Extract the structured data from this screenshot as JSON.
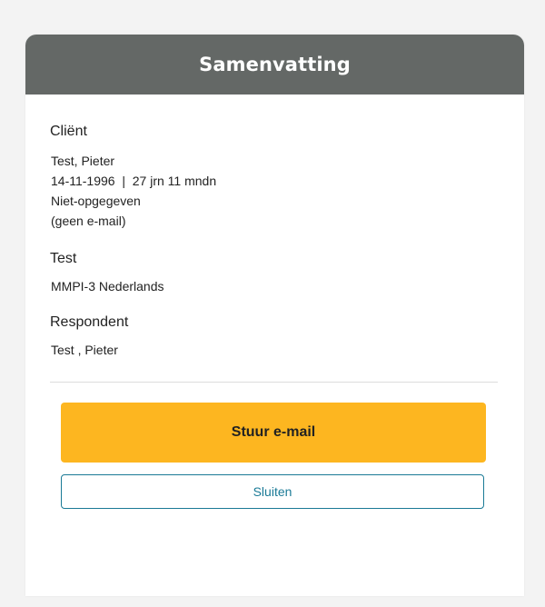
{
  "header": {
    "title": "Samenvatting"
  },
  "client": {
    "label": "Cliënt",
    "name": "Test, Pieter",
    "birth_age": "14-11-1996  |  27 jrn 11 mndn",
    "gender": "Niet-opgegeven",
    "email": "(geen e-mail)"
  },
  "test": {
    "label": "Test",
    "name": "MMPI-3 Nederlands"
  },
  "respondent": {
    "label": "Respondent",
    "name": "Test , Pieter"
  },
  "actions": {
    "send_email_label": "Stuur e-mail",
    "close_label": "Sluiten"
  },
  "colors": {
    "header_bg": "#646866",
    "primary_button": "#fdb620",
    "secondary_button_border": "#1a7a96"
  }
}
